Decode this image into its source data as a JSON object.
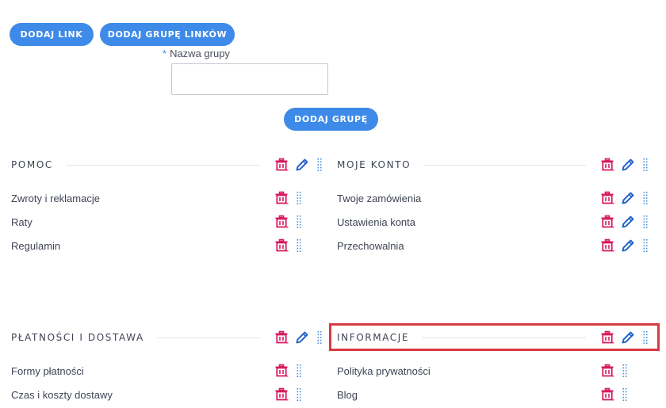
{
  "toolbar": {
    "add_link_label": "DODAJ LINK",
    "add_group_links_label": "DODAJ GRUPĘ LINKÓW"
  },
  "group_form": {
    "required_mark": "*",
    "name_label": "Nazwa grupy",
    "name_value": "",
    "submit_label": "DODAJ GRUPĘ"
  },
  "colors": {
    "primary": "#3d8ae8",
    "delete": "#d81b60",
    "edit": "#1f5fc8",
    "drag": "#4a90d9",
    "highlight": "#d83a42"
  },
  "groups": [
    {
      "title": "POMOC",
      "items": [
        "Zwroty i reklamacje",
        "Raty",
        "Regulamin"
      ]
    },
    {
      "title": "MOJE KONTO",
      "items": [
        "Twoje zamówienia",
        "Ustawienia konta",
        "Przechowalnia"
      ]
    },
    {
      "title": "PŁATNOŚCI I DOSTAWA",
      "items": [
        "Formy płatności",
        "Czas i koszty dostawy"
      ]
    },
    {
      "title": "INFORMACJE",
      "items": [
        "Polityka prywatności",
        "Blog"
      ]
    }
  ]
}
